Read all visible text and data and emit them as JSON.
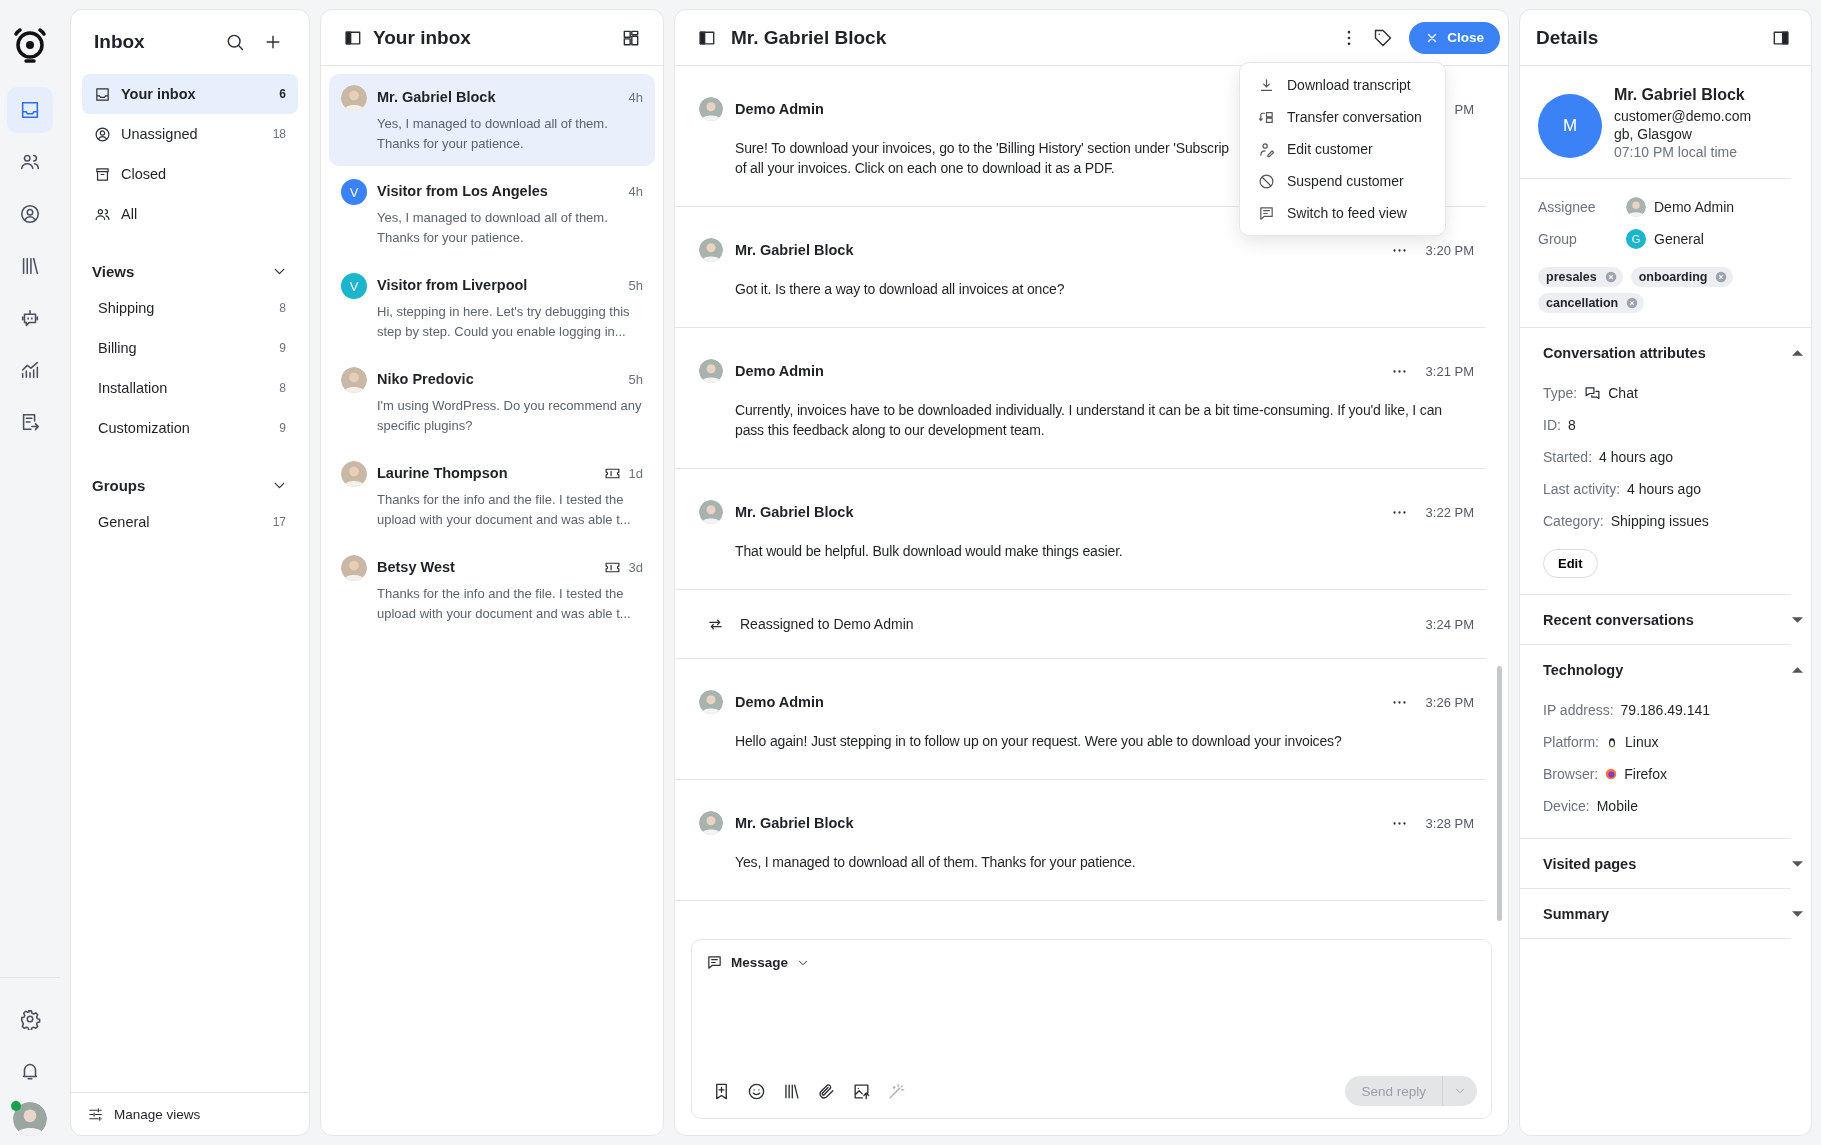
{
  "rail": {
    "items": [
      {
        "selected": true
      },
      {
        "selected": false
      },
      {
        "selected": false
      },
      {
        "selected": false
      },
      {
        "selected": false
      },
      {
        "selected": false
      },
      {
        "selected": false
      }
    ],
    "bottom": [
      {
        "selected": false
      },
      {
        "selected": false
      }
    ],
    "user": {
      "online": true
    }
  },
  "sidebar": {
    "title": "Inbox",
    "items": [
      {
        "label": "Your inbox",
        "count": "6",
        "selected": true
      },
      {
        "label": "Unassigned",
        "count": "18",
        "selected": false
      },
      {
        "label": "Closed",
        "selected": false
      },
      {
        "label": "All",
        "selected": false
      }
    ],
    "sections": [
      {
        "title": "Views",
        "expanded": true,
        "items": [
          {
            "label": "Shipping",
            "count": "8",
            "selected": false
          },
          {
            "label": "Billing",
            "count": "9",
            "selected": false
          },
          {
            "label": "Installation",
            "count": "8",
            "selected": false
          },
          {
            "label": "Customization",
            "count": "9",
            "selected": false
          }
        ]
      },
      {
        "title": "Groups",
        "expanded": true,
        "items": [
          {
            "label": "General",
            "count": "17",
            "selected": false
          }
        ]
      }
    ],
    "footer": "Manage views"
  },
  "list": {
    "title": "Your inbox",
    "conversations": [
      {
        "name": "Mr. Gabriel Block",
        "time": "4h",
        "preview": "Yes, I managed to download all of them. Thanks for your patience.",
        "kind": "photo",
        "selected": true,
        "ticket": false
      },
      {
        "name": "Visitor from Los Angeles",
        "time": "4h",
        "preview": "Yes, I managed to download all of them. Thanks for your patience.",
        "kind": "letter",
        "letter": "V",
        "color": "#3b82f6",
        "selected": false,
        "ticket": false
      },
      {
        "name": "Visitor from Liverpool",
        "time": "5h",
        "preview": "Hi, stepping in here. Let's try debugging this step by step. Could you enable logging in...",
        "kind": "letter",
        "letter": "V",
        "color": "#1bb5cc",
        "selected": false,
        "ticket": false
      },
      {
        "name": "Niko Predovic",
        "time": "5h",
        "preview": "I'm using WordPress. Do you recommend any specific plugins?",
        "kind": "photo",
        "selected": false,
        "ticket": false
      },
      {
        "name": "Laurine Thompson",
        "time": "1d",
        "preview": "Thanks for the info and the file. I tested the upload with your document and was able t...",
        "kind": "photo",
        "selected": false,
        "ticket": true
      },
      {
        "name": "Betsy West",
        "time": "3d",
        "preview": "Thanks for the info and the file. I tested the upload with your document and was able t...",
        "kind": "photo",
        "selected": false,
        "ticket": true
      }
    ]
  },
  "chat": {
    "title": "Mr. Gabriel Block",
    "close": "Close",
    "menu": [
      "Download transcript",
      "Transfer conversation",
      "Edit customer",
      "Suspend customer",
      "Switch to feed view"
    ],
    "events": [
      {
        "kind": "message",
        "author": "Demo Admin",
        "time": "PM",
        "text": "Sure! To download your invoices, go to the 'Billing History' section under 'Subscrip\nof all your invoices. Click on each one to download it as a PDF."
      },
      {
        "kind": "message",
        "author": "Mr. Gabriel Block",
        "time": "3:20 PM",
        "text": "Got it. Is there a way to download all invoices at once?"
      },
      {
        "kind": "message",
        "author": "Demo Admin",
        "time": "3:21 PM",
        "text": "Currently, invoices have to be downloaded individually. I understand it can be a bit time-consuming. If you'd like, I can pass this feedback along to our development team."
      },
      {
        "kind": "message",
        "author": "Mr. Gabriel Block",
        "time": "3:22 PM",
        "text": "That would be helpful. Bulk download would make things easier."
      },
      {
        "kind": "system",
        "text": "Reassigned to Demo Admin",
        "time": "3:24 PM"
      },
      {
        "kind": "message",
        "author": "Demo Admin",
        "time": "3:26 PM",
        "text": "Hello again! Just stepping in to follow up on your request. Were you able to download your invoices?"
      },
      {
        "kind": "message",
        "author": "Mr. Gabriel Block",
        "time": "3:28 PM",
        "text": "Yes, I managed to download all of them. Thanks for your patience."
      }
    ],
    "composer": {
      "mode": "Message",
      "send": "Send reply",
      "disabled": true
    }
  },
  "details": {
    "title": "Details",
    "letter": "M",
    "name": "Mr. Gabriel Block",
    "email": "customer@demo.com",
    "location": "gb, Glasgow",
    "local_time": "07:10 PM local time",
    "people": [
      {
        "label": "Assignee",
        "value": "Demo Admin",
        "kind": "photo"
      },
      {
        "label": "Group",
        "value": "General",
        "kind": "letter",
        "letter": "G",
        "color": "#1bb5cc"
      }
    ],
    "tags": [
      "presales",
      "onboarding",
      "cancellation"
    ],
    "sections": [
      {
        "title": "Conversation attributes",
        "expanded": true,
        "rows": [
          {
            "label": "Type:",
            "value": "Chat"
          },
          {
            "label": "ID:",
            "value": "8"
          },
          {
            "label": "Started:",
            "value": "4 hours ago"
          },
          {
            "label": "Last activity:",
            "value": "4 hours ago"
          },
          {
            "label": "Category:",
            "value": "Shipping issues"
          }
        ],
        "button": "Edit"
      },
      {
        "title": "Recent conversations",
        "expanded": false
      },
      {
        "title": "Technology",
        "expanded": true,
        "rows": [
          {
            "label": "IP address:",
            "value": "79.186.49.141"
          },
          {
            "label": "Platform:",
            "value": "Linux"
          },
          {
            "label": "Browser:",
            "value": "Firefox"
          },
          {
            "label": "Device:",
            "value": "Mobile"
          }
        ]
      },
      {
        "title": "Visited pages",
        "expanded": false
      },
      {
        "title": "Summary",
        "expanded": false
      }
    ]
  }
}
